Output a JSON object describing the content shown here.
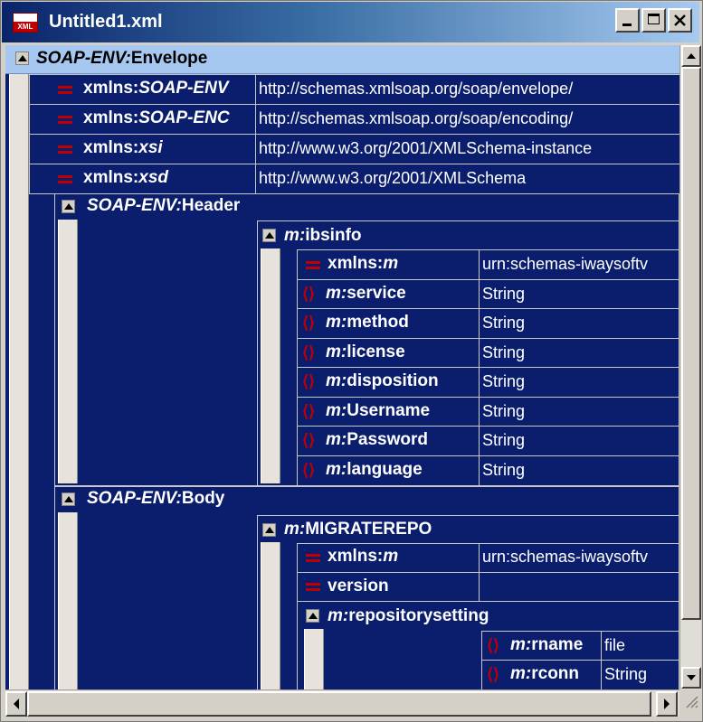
{
  "window": {
    "title": "Untitled1.xml",
    "icon": "xml-file-icon",
    "file_icon_label": "XML"
  },
  "tree": {
    "envelope": {
      "prefix": "SOAP-ENV:",
      "name": "Envelope",
      "attrs": [
        {
          "prefix": "xmlns:",
          "local": "SOAP-ENV",
          "value": "http://schemas.xmlsoap.org/soap/envelope/"
        },
        {
          "prefix": "xmlns:",
          "local": "SOAP-ENC",
          "value": "http://schemas.xmlsoap.org/soap/encoding/"
        },
        {
          "prefix": "xmlns:",
          "local": "xsi",
          "value": "http://www.w3.org/2001/XMLSchema-instance"
        },
        {
          "prefix": "xmlns:",
          "local": "xsd",
          "value": "http://www.w3.org/2001/XMLSchema"
        }
      ]
    },
    "header": {
      "prefix": "SOAP-ENV:",
      "name": "Header",
      "ibsinfo": {
        "prefix": "m:",
        "name": "ibsinfo",
        "xmlns": {
          "prefix": "xmlns:",
          "local": "m",
          "value": "urn:schemas-iwaysoftv"
        },
        "children": [
          {
            "prefix": "m:",
            "name": "service",
            "value": "String"
          },
          {
            "prefix": "m:",
            "name": "method",
            "value": "String"
          },
          {
            "prefix": "m:",
            "name": "license",
            "value": "String"
          },
          {
            "prefix": "m:",
            "name": "disposition",
            "value": "String"
          },
          {
            "prefix": "m:",
            "name": "Username",
            "value": "String"
          },
          {
            "prefix": "m:",
            "name": "Password",
            "value": "String"
          },
          {
            "prefix": "m:",
            "name": "language",
            "value": "String"
          }
        ]
      }
    },
    "body": {
      "prefix": "SOAP-ENV:",
      "name": "Body",
      "migrate": {
        "prefix": "m:",
        "name": "MIGRATEREPO",
        "xmlns": {
          "prefix": "xmlns:",
          "local": "m",
          "value": "urn:schemas-iwaysoftv"
        },
        "version": {
          "name": "version",
          "value": ""
        },
        "repositorysetting": {
          "prefix": "m:",
          "name": "repositorysetting",
          "children": [
            {
              "prefix": "m:",
              "name": "rname",
              "value": "file"
            },
            {
              "prefix": "m:",
              "name": "rconn",
              "value": "String"
            }
          ]
        }
      }
    }
  },
  "colors": {
    "grid_bg": "#0b1e6e",
    "selected_row": "#a6c8f0",
    "icon_red": "#c00000",
    "gridline": "#c8c8c8"
  }
}
